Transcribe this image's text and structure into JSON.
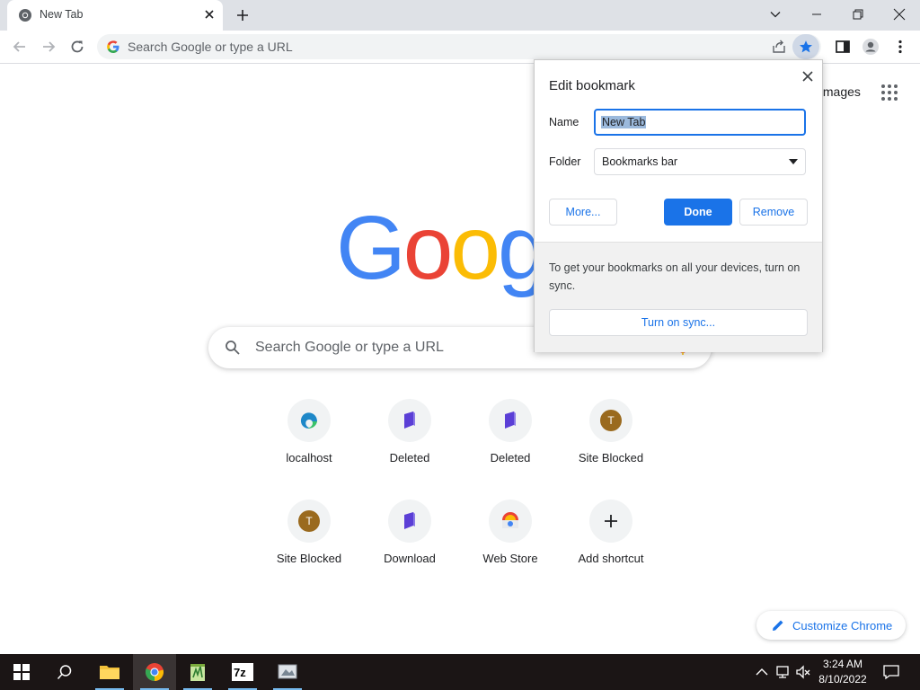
{
  "window": {
    "tab_title": "New Tab"
  },
  "toolbar": {
    "omnibox_placeholder": "Search Google or type a URL"
  },
  "ntp": {
    "images_link": "Images",
    "logo_letters": [
      "G",
      "o",
      "o",
      "g"
    ],
    "search_placeholder": "Search Google or type a URL",
    "shortcuts": [
      {
        "label": "localhost",
        "icon": "edge-icon"
      },
      {
        "label": "Deleted",
        "icon": "purple-shield-icon"
      },
      {
        "label": "Deleted",
        "icon": "purple-shield-icon"
      },
      {
        "label": "Site Blocked",
        "icon": "letter-avatar",
        "letter": "T"
      },
      {
        "label": "Site Blocked",
        "icon": "letter-avatar",
        "letter": "T"
      },
      {
        "label": "Download",
        "icon": "purple-shield-icon"
      },
      {
        "label": "Web Store",
        "icon": "web-store-icon"
      },
      {
        "label": "Add shortcut",
        "icon": "plus-icon"
      }
    ],
    "customize_label": "Customize Chrome"
  },
  "bookmark_bubble": {
    "title": "Edit bookmark",
    "name_label": "Name",
    "name_value": "New Tab",
    "folder_label": "Folder",
    "folder_value": "Bookmarks bar",
    "more_label": "More...",
    "done_label": "Done",
    "remove_label": "Remove",
    "sync_text": "To get your bookmarks on all your devices, turn on sync.",
    "sync_button": "Turn on sync..."
  },
  "taskbar": {
    "time": "3:24 AM",
    "date": "8/10/2022"
  },
  "colors": {
    "accent": "#1a73e8",
    "logo_blue": "#4285f4",
    "logo_red": "#ea4335",
    "logo_yellow": "#fbbc05",
    "logo_green": "#34a853"
  }
}
